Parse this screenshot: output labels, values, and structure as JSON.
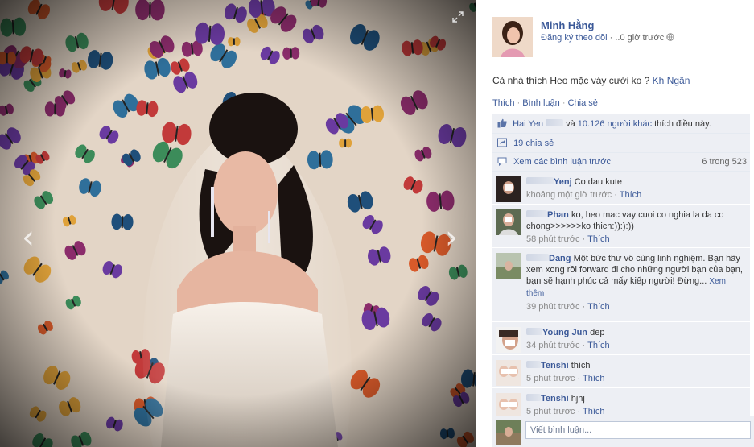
{
  "photo": {
    "prev_label": "‹",
    "next_label": "›",
    "colors": {
      "wall": "#e9ddd0",
      "dress": "#f3ece4",
      "hair": "#1a1210",
      "skin": "#e8b9a4"
    }
  },
  "post": {
    "author": "Minh Hằng",
    "follow_label": "Đăng ký theo dõi",
    "separator": " · ",
    "time": "..0 giờ trước",
    "caption_text": "Cả nhà thích Heo mặc váy cưới ko ?",
    "caption_tags": [
      "Kh",
      "Ngân"
    ],
    "actions": {
      "like": "Thích",
      "comment": "Bình luận",
      "share": "Chia sẻ",
      "sep": " · "
    }
  },
  "ufi": {
    "likes": {
      "name1": "Hai Yen",
      "and": " và ",
      "others": "10.126 người khác",
      "suffix": " thích điều này."
    },
    "shares": "19 chia sẻ",
    "view_previous": "Xem các bình luận trước",
    "pager": "6 trong 523"
  },
  "comments": [
    {
      "author": "Yenj",
      "text": "Co dau kute",
      "time": "khoảng một giờ trước",
      "like": "Thích"
    },
    {
      "author": "Phan",
      "text": "ko, heo mac vay cuoi co nghia la da co chong>>>>>>ko thich:)):):))",
      "time": "58 phút trước",
      "like": "Thích"
    },
    {
      "author": "Dang",
      "text": "Một bức thư vô cùng linh nghiệm. Bạn hãy xem xong rồi forward đi cho những người bạn của bạn, bạn sẽ hạnh phúc cả mấy kiếp người! Đừng...",
      "see_more": "Xem thêm",
      "time": "39 phút trước",
      "like": "Thích"
    },
    {
      "author": "Young Jun",
      "text": "dep",
      "time": "34 phút trước",
      "like": "Thích"
    },
    {
      "author": "Tenshi",
      "text": "thích",
      "time": "5 phút trước",
      "like": "Thích"
    },
    {
      "author": "Tenshi",
      "text": "hjhj",
      "time": "5 phút trước",
      "like": "Thích"
    }
  ],
  "composer": {
    "placeholder": "Viết bình luận..."
  },
  "meta_sep": " · "
}
